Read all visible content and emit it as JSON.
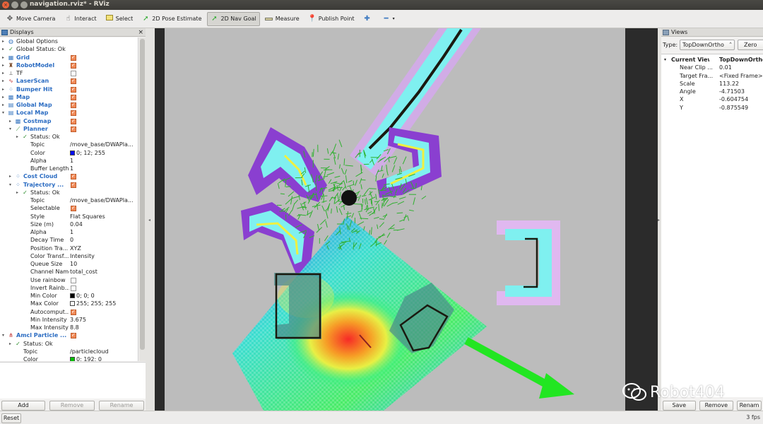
{
  "window": {
    "title": "navigation.rviz* - RViz"
  },
  "toolbar": {
    "items": [
      {
        "label": "Move Camera",
        "icon": "move-camera-icon",
        "active": false
      },
      {
        "label": "Interact",
        "icon": "interact-hand-icon",
        "active": false
      },
      {
        "label": "Select",
        "icon": "select-icon",
        "active": false
      },
      {
        "label": "2D Pose Estimate",
        "icon": "pose-estimate-icon",
        "active": false
      },
      {
        "label": "2D Nav Goal",
        "icon": "nav-goal-icon",
        "active": true
      },
      {
        "label": "Measure",
        "icon": "measure-icon",
        "active": false
      },
      {
        "label": "Publish Point",
        "icon": "publish-point-icon",
        "active": false
      }
    ]
  },
  "displays": {
    "title": "Displays",
    "rows": [
      {
        "name": "Global Options",
        "indent": 0,
        "arrow": "▸",
        "icon": "globe-icon",
        "icolor": "#3b78c0"
      },
      {
        "name": "Global Status: Ok",
        "indent": 0,
        "arrow": "▸",
        "icon": "check-icon",
        "icolor": "#2a8a2a"
      },
      {
        "name": "Grid",
        "indent": 0,
        "arrow": "▸",
        "icon": "grid-icon",
        "icolor": "#3b78c0",
        "blue": true,
        "check": true
      },
      {
        "name": "RobotModel",
        "indent": 0,
        "arrow": "▸",
        "icon": "robot-icon",
        "icolor": "#7a4a2a",
        "blue": true,
        "check": true
      },
      {
        "name": "TF",
        "indent": 0,
        "arrow": "▸",
        "icon": "tf-icon",
        "icolor": "#666",
        "blue": false,
        "check": false
      },
      {
        "name": "LaserScan",
        "indent": 0,
        "arrow": "▸",
        "icon": "laser-icon",
        "icolor": "#c03030",
        "blue": true,
        "check": true
      },
      {
        "name": "Bumper Hit",
        "indent": 0,
        "arrow": "▸",
        "icon": "points-icon",
        "icolor": "#3b78c0",
        "blue": true,
        "check": true
      },
      {
        "name": "Map",
        "indent": 0,
        "arrow": "▸",
        "icon": "map-icon",
        "icolor": "#3b78c0",
        "blue": true,
        "check": true
      },
      {
        "name": "Global Map",
        "indent": 0,
        "arrow": "▸",
        "icon": "folder-icon",
        "icolor": "#3b78c0",
        "blue": true,
        "check": true
      },
      {
        "name": "Local Map",
        "indent": 0,
        "arrow": "▾",
        "icon": "folder-icon",
        "icolor": "#3b78c0",
        "blue": true,
        "check": true
      },
      {
        "name": "Costmap",
        "indent": 1,
        "arrow": "▸",
        "icon": "map-icon",
        "icolor": "#3b78c0",
        "blue": true,
        "check": true
      },
      {
        "name": "Planner",
        "indent": 1,
        "arrow": "▾",
        "icon": "path-icon",
        "icolor": "#2a8a2a",
        "blue": true,
        "check": true
      },
      {
        "name": "Status: Ok",
        "indent": 2,
        "arrow": "▸",
        "icon": "check-icon",
        "icolor": "#2a8a2a"
      },
      {
        "name": "Topic",
        "indent": 3,
        "value": "/move_base/DWAPla..."
      },
      {
        "name": "Color",
        "indent": 3,
        "value": "0; 12; 255",
        "swatch": "#000cff"
      },
      {
        "name": "Alpha",
        "indent": 3,
        "value": "1"
      },
      {
        "name": "Buffer Length",
        "indent": 3,
        "value": "1"
      },
      {
        "name": "Cost Cloud",
        "indent": 1,
        "arrow": "▸",
        "icon": "points-icon",
        "icolor": "#3b78c0",
        "blue": true,
        "check": true
      },
      {
        "name": "Trajectory ...",
        "indent": 1,
        "arrow": "▾",
        "icon": "points-icon",
        "icolor": "#3b78c0",
        "blue": true,
        "check": true
      },
      {
        "name": "Status: Ok",
        "indent": 2,
        "arrow": "▸",
        "icon": "check-icon",
        "icolor": "#2a8a2a"
      },
      {
        "name": "Topic",
        "indent": 3,
        "value": "/move_base/DWAPla..."
      },
      {
        "name": "Selectable",
        "indent": 3,
        "check": true
      },
      {
        "name": "Style",
        "indent": 3,
        "value": "Flat Squares"
      },
      {
        "name": "Size (m)",
        "indent": 3,
        "value": "0.04"
      },
      {
        "name": "Alpha",
        "indent": 3,
        "value": "1"
      },
      {
        "name": "Decay Time",
        "indent": 3,
        "value": "0"
      },
      {
        "name": "Position Tra...",
        "indent": 3,
        "value": "XYZ"
      },
      {
        "name": "Color Transf...",
        "indent": 3,
        "value": "Intensity"
      },
      {
        "name": "Queue Size",
        "indent": 3,
        "value": "10"
      },
      {
        "name": "Channel Name",
        "indent": 3,
        "value": "total_cost"
      },
      {
        "name": "Use rainbow",
        "indent": 3,
        "check": false
      },
      {
        "name": "Invert Rainb...",
        "indent": 3,
        "check": false
      },
      {
        "name": "Min Color",
        "indent": 3,
        "value": "0; 0; 0",
        "swatch": "#000000"
      },
      {
        "name": "Max Color",
        "indent": 3,
        "value": "255; 255; 255",
        "swatch": "#ffffff"
      },
      {
        "name": "Autocomput...",
        "indent": 3,
        "check": true
      },
      {
        "name": "Min Intensity",
        "indent": 3,
        "value": "3.675"
      },
      {
        "name": "Max Intensity",
        "indent": 3,
        "value": "8.8"
      },
      {
        "name": "Amcl Particle ...",
        "indent": 0,
        "arrow": "▾",
        "icon": "pose-array-icon",
        "icolor": "#c03030",
        "blue": true,
        "check": true
      },
      {
        "name": "Status: Ok",
        "indent": 1,
        "arrow": "▸",
        "icon": "check-icon",
        "icolor": "#2a8a2a"
      },
      {
        "name": "Topic",
        "indent": 2,
        "value": "/particlecloud"
      },
      {
        "name": "Color",
        "indent": 2,
        "value": "0; 192; 0",
        "swatch": "#00c000"
      }
    ],
    "buttons": [
      {
        "label": "Add",
        "disabled": false
      },
      {
        "label": "Remove",
        "disabled": true
      },
      {
        "label": "Rename",
        "disabled": true
      }
    ]
  },
  "views": {
    "title": "Views",
    "type_label": "Type:",
    "type_value": "TopDownOrtho",
    "zero_label": "Zero",
    "header": {
      "key": "Current View",
      "value": "TopDownOrtho"
    },
    "props": [
      {
        "key": "Near Clip ...",
        "value": "0.01"
      },
      {
        "key": "Target Fra...",
        "value": "<Fixed Frame>"
      },
      {
        "key": "Scale",
        "value": "113.22"
      },
      {
        "key": "Angle",
        "value": "-4.71503"
      },
      {
        "key": "X",
        "value": "-0.604754"
      },
      {
        "key": "Y",
        "value": "-0.875549"
      }
    ],
    "buttons": [
      {
        "label": "Save"
      },
      {
        "label": "Remove"
      },
      {
        "label": "Renam"
      }
    ]
  },
  "statusbar": {
    "reset_label": "Reset",
    "fps": "3 fps"
  },
  "watermark": {
    "text": "Robot404"
  },
  "colors": {
    "map_gray": "#bcbcbc",
    "goal_arrow": "#22e622",
    "costmap_cyan": "#7ff0f0",
    "costmap_violet": "#8a3fd0",
    "planner_path": "#1a1a10"
  }
}
